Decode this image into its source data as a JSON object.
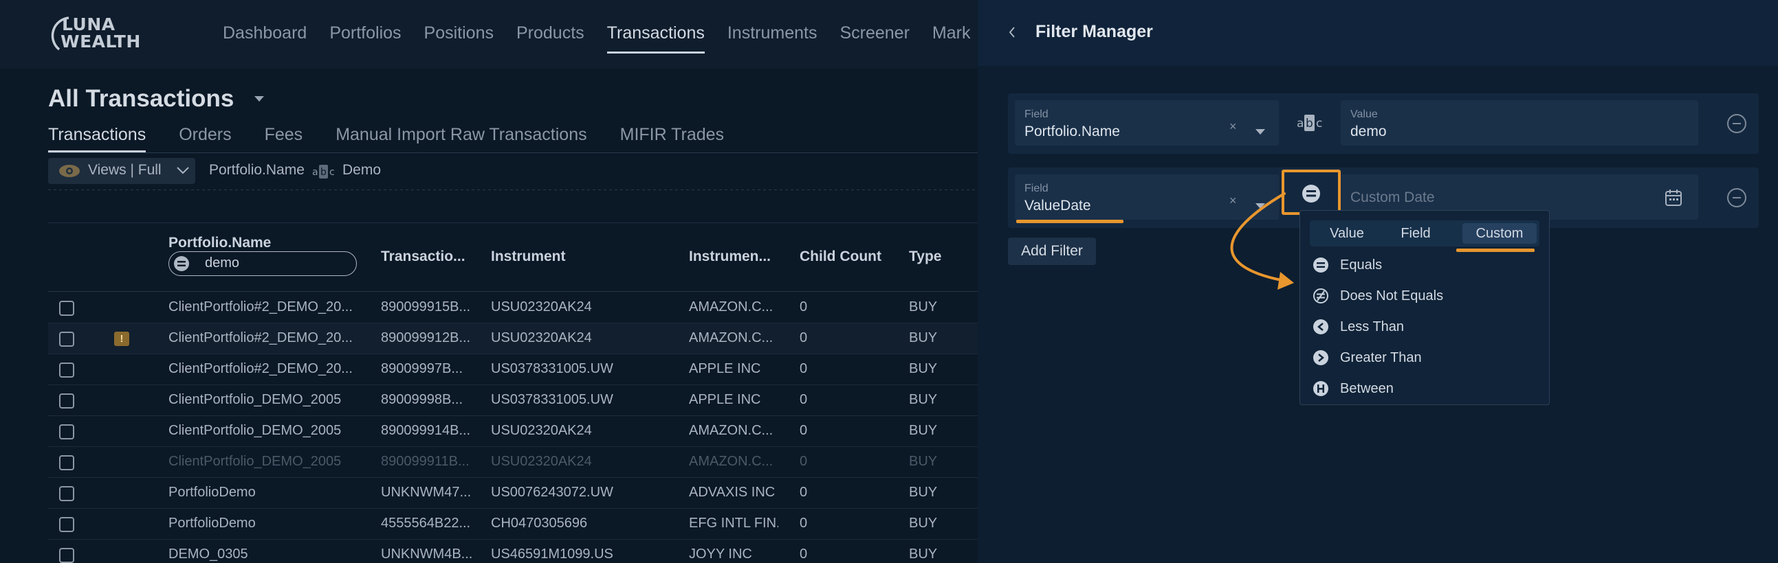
{
  "brand": {
    "line1": "LUNA",
    "line2": "WEALTH"
  },
  "nav": [
    "Dashboard",
    "Portfolios",
    "Positions",
    "Products",
    "Transactions",
    "Instruments",
    "Screener",
    "Mark"
  ],
  "page": {
    "title": "All Transactions"
  },
  "subtabs": [
    "Transactions",
    "Orders",
    "Fees",
    "Manual Import Raw Transactions",
    "MIFIR Trades"
  ],
  "toolbar": {
    "views_label": "Views | Full",
    "filter_field": "Portfolio.Name",
    "filter_value": "Demo"
  },
  "table": {
    "headers": [
      "Portfolio.Name",
      "Transactio...",
      "Instrument",
      "Instrumen...",
      "Child Count",
      "Type"
    ],
    "column_filter_value": "demo",
    "rows": [
      [
        "ClientPortfolio#2_DEMO_20...",
        "890099915B...",
        "USU02320AK24",
        "AMAZON.C...",
        "0",
        "BUY"
      ],
      [
        "ClientPortfolio#2_DEMO_20...",
        "890099912B...",
        "USU02320AK24",
        "AMAZON.C...",
        "0",
        "BUY"
      ],
      [
        "ClientPortfolio#2_DEMO_20...",
        "89009997B...",
        "US0378331005.UW",
        "APPLE INC",
        "0",
        "BUY"
      ],
      [
        "ClientPortfolio_DEMO_2005",
        "89009998B...",
        "US0378331005.UW",
        "APPLE INC",
        "0",
        "BUY"
      ],
      [
        "ClientPortfolio_DEMO_2005",
        "890099914B...",
        "USU02320AK24",
        "AMAZON.C...",
        "0",
        "BUY"
      ],
      [
        "ClientPortfolio_DEMO_2005",
        "890099911B...",
        "USU02320AK24",
        "AMAZON.C...",
        "0",
        "BUY"
      ],
      [
        "PortfolioDemo",
        "UNKNWM47...",
        "US0076243072.UW",
        "ADVAXIS INC",
        "0",
        "BUY"
      ],
      [
        "PortfolioDemo",
        "4555564B22...",
        "CH0470305696",
        "EFG INTL FIN...",
        "0",
        "BUY"
      ],
      [
        "DEMO_0305",
        "UNKNWM4B...",
        "US46591M1099.US",
        "JOYY INC",
        "0",
        "BUY"
      ]
    ]
  },
  "filter_manager": {
    "title": "Filter Manager",
    "filters": [
      {
        "field_label": "Field",
        "field_value": "Portfolio.Name",
        "operator_icon": "abc-icon",
        "value_label": "Value",
        "value": "demo"
      },
      {
        "field_label": "Field",
        "field_value": "ValueDate",
        "operator_icon": "equals-icon",
        "value_placeholder": "Custom Date"
      }
    ],
    "add_filter_label": "Add Filter",
    "clear_glyph": "×",
    "operator_menu": {
      "tabs": [
        "Value",
        "Field",
        "Custom"
      ],
      "active_tab": "Custom",
      "options": [
        "Equals",
        "Does Not Equals",
        "Less Than",
        "Greater Than",
        "Between"
      ]
    }
  },
  "colors": {
    "accent": "#e8962e",
    "panel": "#0d1e30",
    "background": "#0b1826"
  }
}
